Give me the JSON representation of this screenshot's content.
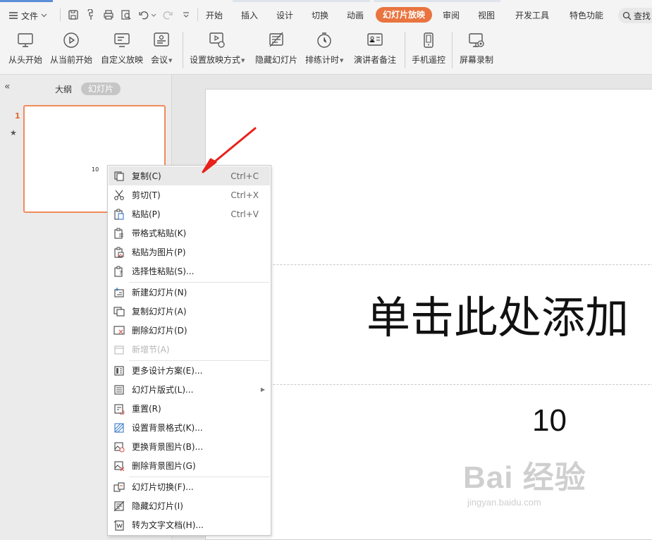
{
  "menubar": {
    "file_label": "文件",
    "tabs": [
      "开始",
      "插入",
      "设计",
      "切换",
      "动画",
      "幻灯片放映",
      "审阅",
      "视图",
      "开发工具",
      "特色功能"
    ],
    "active_tab": "幻灯片放映",
    "search_label": "查找"
  },
  "ribbon": {
    "buttons": [
      {
        "label": "从头开始",
        "icon": "play-from-start-icon"
      },
      {
        "label": "从当前开始",
        "icon": "play-from-current-icon"
      },
      {
        "label": "自定义放映",
        "icon": "custom-show-icon"
      },
      {
        "label": "会议",
        "icon": "meeting-icon"
      },
      {
        "label": "设置放映方式",
        "icon": "setup-show-icon"
      },
      {
        "label": "隐藏幻灯片",
        "icon": "hide-slide-icon"
      },
      {
        "label": "排练计时",
        "icon": "rehearse-timing-icon"
      },
      {
        "label": "演讲者备注",
        "icon": "speaker-notes-icon"
      },
      {
        "label": "手机遥控",
        "icon": "phone-remote-icon"
      },
      {
        "label": "屏幕录制",
        "icon": "screen-record-icon"
      }
    ]
  },
  "sidepanel": {
    "tab_outline": "大纲",
    "tab_slides": "幻灯片",
    "slide_number": "1",
    "thumb_text": "10"
  },
  "slide": {
    "title_placeholder": "单击此处添加",
    "subtitle": "10"
  },
  "watermark": {
    "main": "Bai 经验",
    "sub": "jingyan.baidu.com"
  },
  "context_menu": {
    "items": [
      {
        "label": "复制(C)",
        "shortcut": "Ctrl+C",
        "icon": "copy-icon",
        "state": "hover"
      },
      {
        "label": "剪切(T)",
        "shortcut": "Ctrl+X",
        "icon": "scissors-icon"
      },
      {
        "label": "粘贴(P)",
        "shortcut": "Ctrl+V",
        "icon": "paste-icon"
      },
      {
        "label": "带格式粘贴(K)",
        "icon": "paste-formatted-icon"
      },
      {
        "label": "粘贴为图片(P)",
        "icon": "paste-as-picture-icon"
      },
      {
        "label": "选择性粘贴(S)...",
        "icon": "paste-special-icon"
      },
      {
        "label": "新建幻灯片(N)",
        "icon": "new-slide-icon"
      },
      {
        "label": "复制幻灯片(A)",
        "icon": "duplicate-slide-icon"
      },
      {
        "label": "删除幻灯片(D)",
        "icon": "delete-slide-icon"
      },
      {
        "label": "新增节(A)",
        "icon": "add-section-icon",
        "state": "disabled"
      },
      {
        "label": "更多设计方案(E)...",
        "icon": "more-designs-icon"
      },
      {
        "label": "幻灯片版式(L)...",
        "icon": "slide-layout-icon",
        "submenu": true
      },
      {
        "label": "重置(R)",
        "icon": "reset-icon"
      },
      {
        "label": "设置背景格式(K)...",
        "icon": "background-format-icon"
      },
      {
        "label": "更换背景图片(B)...",
        "icon": "change-background-icon"
      },
      {
        "label": "删除背景图片(G)",
        "icon": "delete-background-icon"
      },
      {
        "label": "幻灯片切换(F)...",
        "icon": "slide-transition-icon"
      },
      {
        "label": "隐藏幻灯片(I)",
        "icon": "hide-slide-icon"
      },
      {
        "label": "转为文字文档(H)...",
        "icon": "convert-to-doc-icon"
      }
    ]
  },
  "colors": {
    "accent": "#e9743f",
    "selection_border": "#f08a5d",
    "annotation_arrow": "#e8201b"
  }
}
